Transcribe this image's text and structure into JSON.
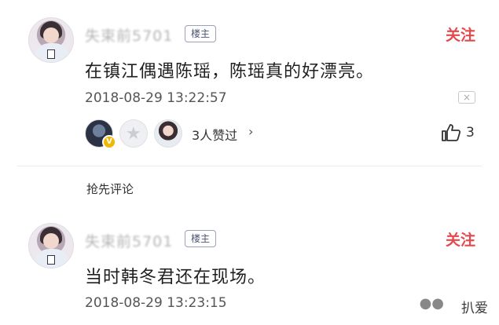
{
  "posts": [
    {
      "user_name": "失束前5701",
      "owner_tag": "楼主",
      "follow_label": "关注",
      "content": "在镇江偶遇陈瑶，陈瑶真的好漂亮。",
      "timestamp": "2018-08-29 13:22:57",
      "close_label": "×",
      "likers_text": "3人赞过",
      "chevron": "›",
      "like_count": "3"
    },
    {
      "user_name": "失束前5701",
      "owner_tag": "楼主",
      "follow_label": "关注",
      "content": "当时韩冬君还在现场。",
      "timestamp": "2018-08-29 13:23:15"
    }
  ],
  "section": {
    "grab_comment": "抢先评论"
  },
  "watermark": {
    "text": "扒爱"
  },
  "colors": {
    "accent": "#e5484d",
    "text": "#1f1f1f",
    "meta": "#555555",
    "divider": "#ececec"
  },
  "icons": [
    "avatar",
    "v-badge",
    "star-icon",
    "chevron-right-icon",
    "thumbs-up-icon",
    "close-icon",
    "wechat-icon"
  ]
}
